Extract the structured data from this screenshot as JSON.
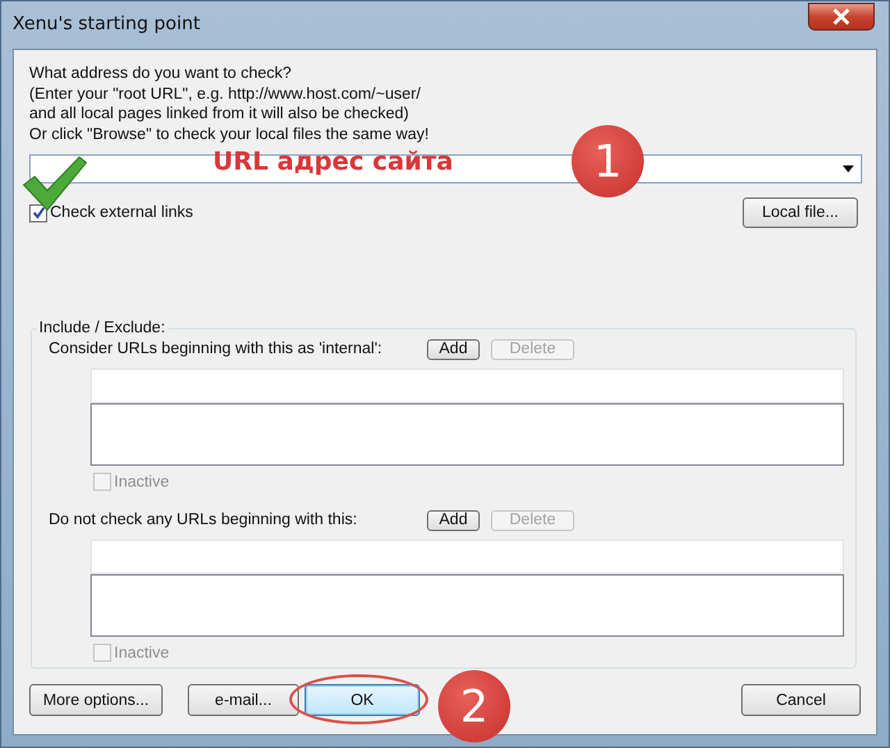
{
  "window": {
    "title": "Xenu's starting point"
  },
  "intro": [
    "What address do you want to check?",
    "(Enter your \"root URL\", e.g. http://www.host.com/~user/",
    "and all local pages linked from it will also be checked)",
    "Or click \"Browse\" to check your local files the same way!"
  ],
  "check_external": {
    "label": "Check external links",
    "checked": true
  },
  "local_file_button": "Local file...",
  "include_exclude": {
    "title": "Include / Exclude:",
    "sections": [
      {
        "label": "Consider URLs beginning with this as 'internal':",
        "add": "Add",
        "delete": "Delete",
        "delete_disabled": true,
        "inactive": {
          "label": "Inactive",
          "checked": false,
          "disabled": true
        }
      },
      {
        "label": "Do not check any URLs beginning with this:",
        "add": "Add",
        "delete": "Delete",
        "delete_disabled": true,
        "inactive": {
          "label": "Inactive",
          "checked": false,
          "disabled": true
        }
      }
    ]
  },
  "buttons": [
    {
      "label": "More options...",
      "default": false,
      "highlighted": false
    },
    {
      "label": "e-mail...",
      "default": false,
      "highlighted": false
    },
    {
      "label": "OK",
      "default": true,
      "highlighted": true
    },
    {
      "label": "Cancel",
      "default": false,
      "highlighted": false
    }
  ],
  "annotations": [
    {
      "kind": "text",
      "text": "URL адрес сайта"
    },
    {
      "kind": "badge",
      "text": "1"
    },
    {
      "kind": "checkmark"
    },
    {
      "kind": "badge",
      "text": "2"
    }
  ]
}
